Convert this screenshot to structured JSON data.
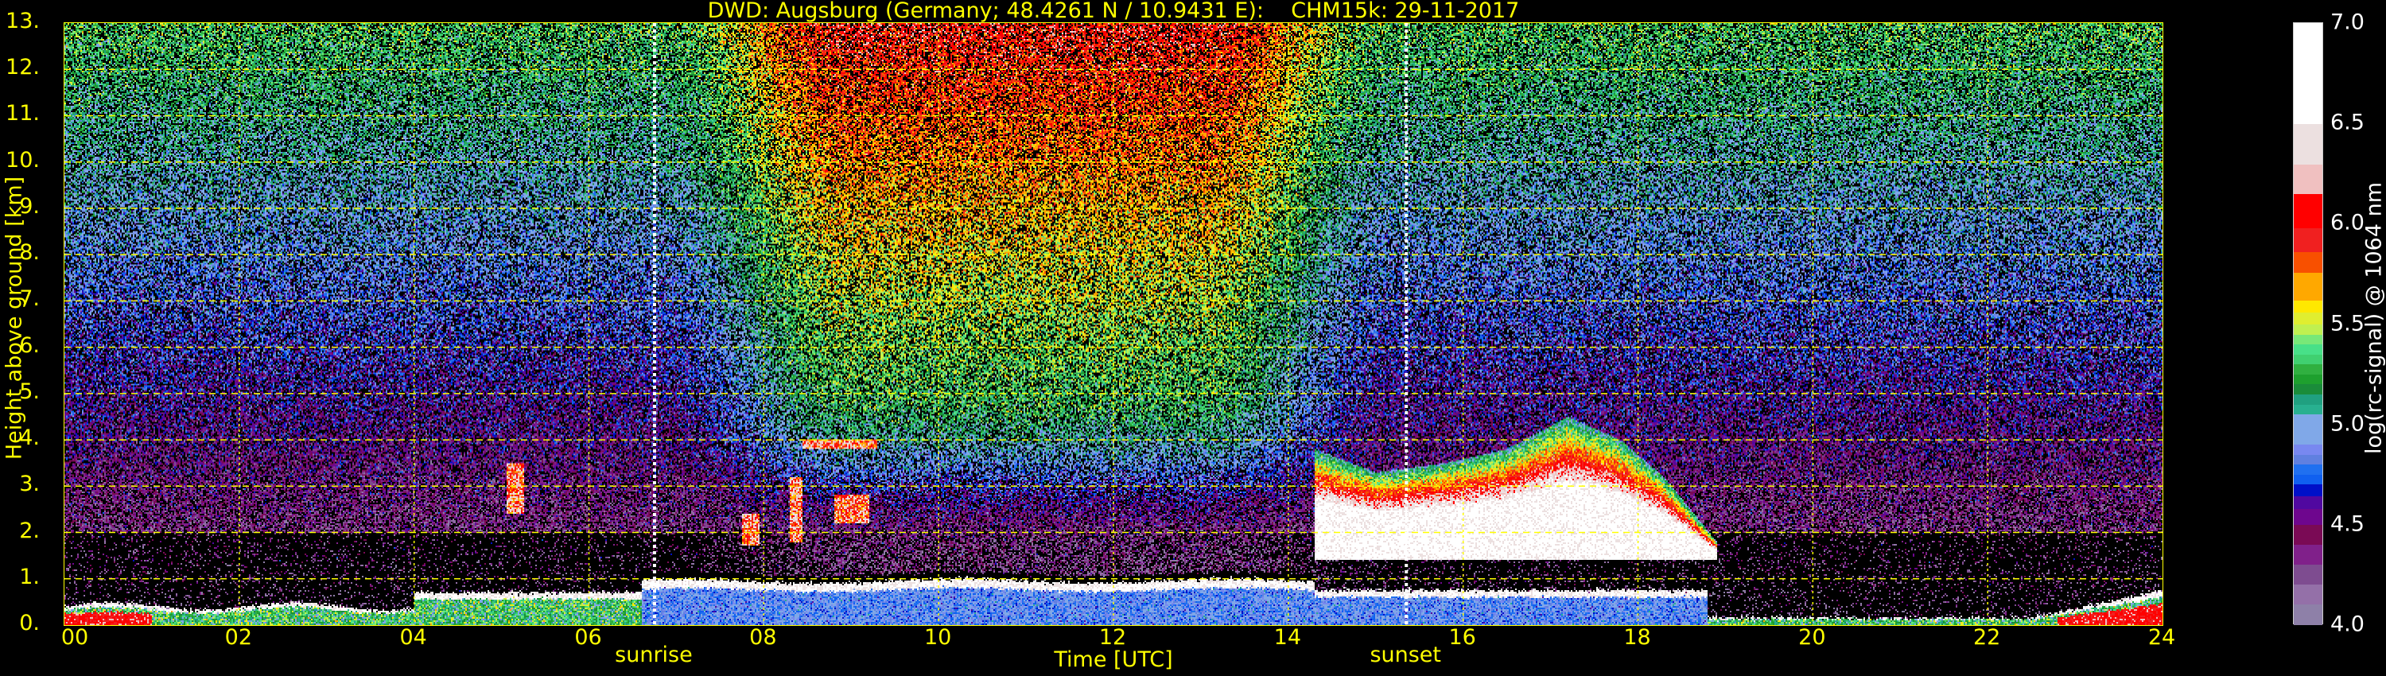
{
  "chart_data": {
    "type": "heatmap",
    "title": "DWD: Augsburg (Germany; 48.4261 N / 10.9431 E):    CHM15k: 29-11-2017",
    "xlabel": "Time [UTC]",
    "ylabel": "Height above ground [km]",
    "xlim": [
      0,
      24
    ],
    "ylim": [
      0,
      13
    ],
    "x_ticks": [
      "00",
      "02",
      "04",
      "06",
      "08",
      "10",
      "12",
      "14",
      "16",
      "18",
      "20",
      "22",
      "24"
    ],
    "y_ticks": [
      "0.",
      "1.",
      "2.",
      "3.",
      "4.",
      "5.",
      "6.",
      "7.",
      "8.",
      "9.",
      "10.",
      "11.",
      "12.",
      "13."
    ],
    "grid": true,
    "annotations": [
      {
        "label": "sunrise",
        "time_utc": 6.75
      },
      {
        "label": "sunset",
        "time_utc": 15.35
      }
    ],
    "colorbar": {
      "label": "log(rc-signal) @ 1064 nm",
      "range": [
        4.0,
        7.0
      ],
      "ticks": [
        "4.0",
        "4.5",
        "5.0",
        "5.5",
        "6.0",
        "6.5",
        "7.0"
      ],
      "levels": [
        {
          "from": 4.0,
          "to": 4.1,
          "color": "#8e80a8"
        },
        {
          "from": 4.1,
          "to": 4.2,
          "color": "#9470a8"
        },
        {
          "from": 4.2,
          "to": 4.3,
          "color": "#7e4c90"
        },
        {
          "from": 4.3,
          "to": 4.4,
          "color": "#80208a"
        },
        {
          "from": 4.4,
          "to": 4.5,
          "color": "#7a0a55"
        },
        {
          "from": 4.5,
          "to": 4.58,
          "color": "#6e068e"
        },
        {
          "from": 4.58,
          "to": 4.64,
          "color": "#5008a0"
        },
        {
          "from": 4.64,
          "to": 4.7,
          "color": "#0010c8"
        },
        {
          "from": 4.7,
          "to": 4.75,
          "color": "#1060f0"
        },
        {
          "from": 4.75,
          "to": 4.8,
          "color": "#2070f0"
        },
        {
          "from": 4.8,
          "to": 4.85,
          "color": "#6080e0"
        },
        {
          "from": 4.85,
          "to": 4.9,
          "color": "#7888f0"
        },
        {
          "from": 4.9,
          "to": 5.05,
          "color": "#80a8e8"
        },
        {
          "from": 5.05,
          "to": 5.1,
          "color": "#28b090"
        },
        {
          "from": 5.1,
          "to": 5.15,
          "color": "#20a080"
        },
        {
          "from": 5.15,
          "to": 5.2,
          "color": "#1a8c3a"
        },
        {
          "from": 5.2,
          "to": 5.25,
          "color": "#1ea02e"
        },
        {
          "from": 5.25,
          "to": 5.3,
          "color": "#30b040"
        },
        {
          "from": 5.3,
          "to": 5.35,
          "color": "#40d070"
        },
        {
          "from": 5.35,
          "to": 5.4,
          "color": "#48e088"
        },
        {
          "from": 5.4,
          "to": 5.45,
          "color": "#78e878"
        },
        {
          "from": 5.45,
          "to": 5.5,
          "color": "#c0f050"
        },
        {
          "from": 5.5,
          "to": 5.56,
          "color": "#e0ee30"
        },
        {
          "from": 5.56,
          "to": 5.62,
          "color": "#ffe800"
        },
        {
          "from": 5.62,
          "to": 5.76,
          "color": "#ffa800"
        },
        {
          "from": 5.76,
          "to": 5.86,
          "color": "#f85000"
        },
        {
          "from": 5.86,
          "to": 5.98,
          "color": "#f02020"
        },
        {
          "from": 5.98,
          "to": 6.15,
          "color": "#ff0000"
        },
        {
          "from": 6.15,
          "to": 6.3,
          "color": "#f0c0c0"
        },
        {
          "from": 6.3,
          "to": 6.5,
          "color": "#ece0e0"
        },
        {
          "from": 6.5,
          "to": 7.0,
          "color": "#ffffff"
        }
      ]
    },
    "axis_color": "#ffff00",
    "grid_color": "#ffff00",
    "annotation_line_color": "#ffffff"
  }
}
